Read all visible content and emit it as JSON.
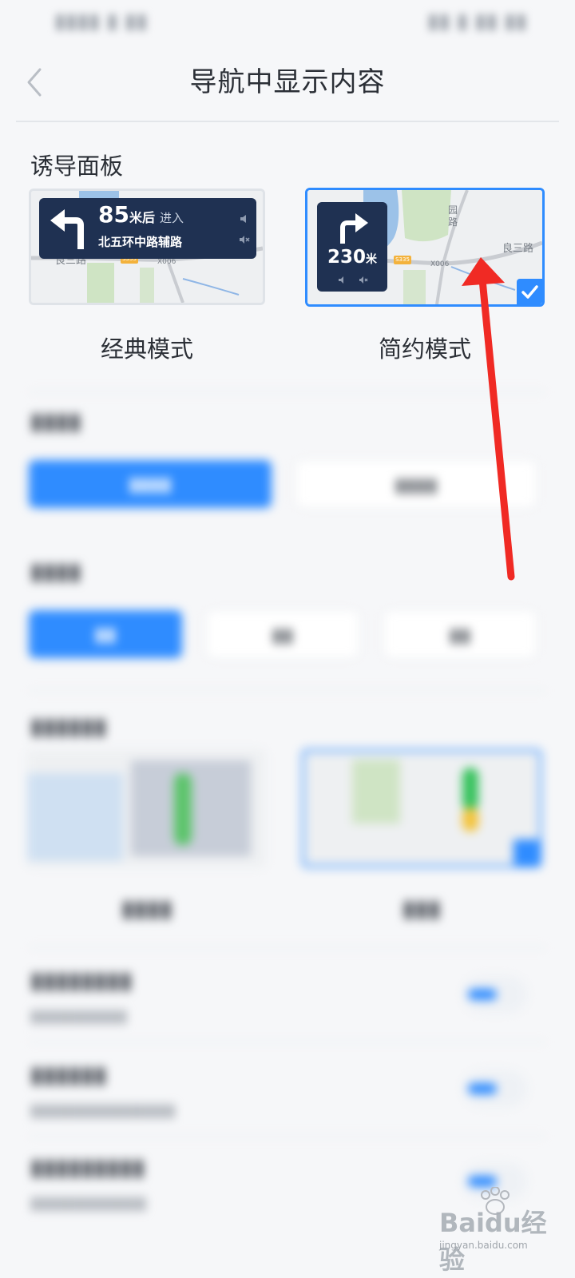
{
  "header": {
    "title": "导航中显示内容"
  },
  "guidance_panel": {
    "title": "诱导面板",
    "options": [
      {
        "label": "经典模式",
        "selected": false,
        "distance_value": "85",
        "distance_unit": "米后",
        "action": "进入",
        "road": "北五环中路辅路"
      },
      {
        "label": "简约模式",
        "selected": true,
        "distance_value": "230",
        "distance_unit": "米"
      }
    ],
    "map_labels": {
      "road_name": "良三路",
      "road_code": "X006",
      "road_badge": "S335",
      "vertical_road": "园路"
    }
  },
  "colors": {
    "accent": "#2f8cff",
    "panel": "#1f3152",
    "annotation_arrow": "#f02a24"
  },
  "icons": [
    "back-icon",
    "turn-left-arrow-icon",
    "turn-right-arrow-icon",
    "speaker-icon",
    "mute-icon",
    "checkmark-icon",
    "red-annotation-arrow"
  ],
  "watermark": {
    "text": "Baidu经验",
    "url": "jingyan.baidu.com"
  }
}
